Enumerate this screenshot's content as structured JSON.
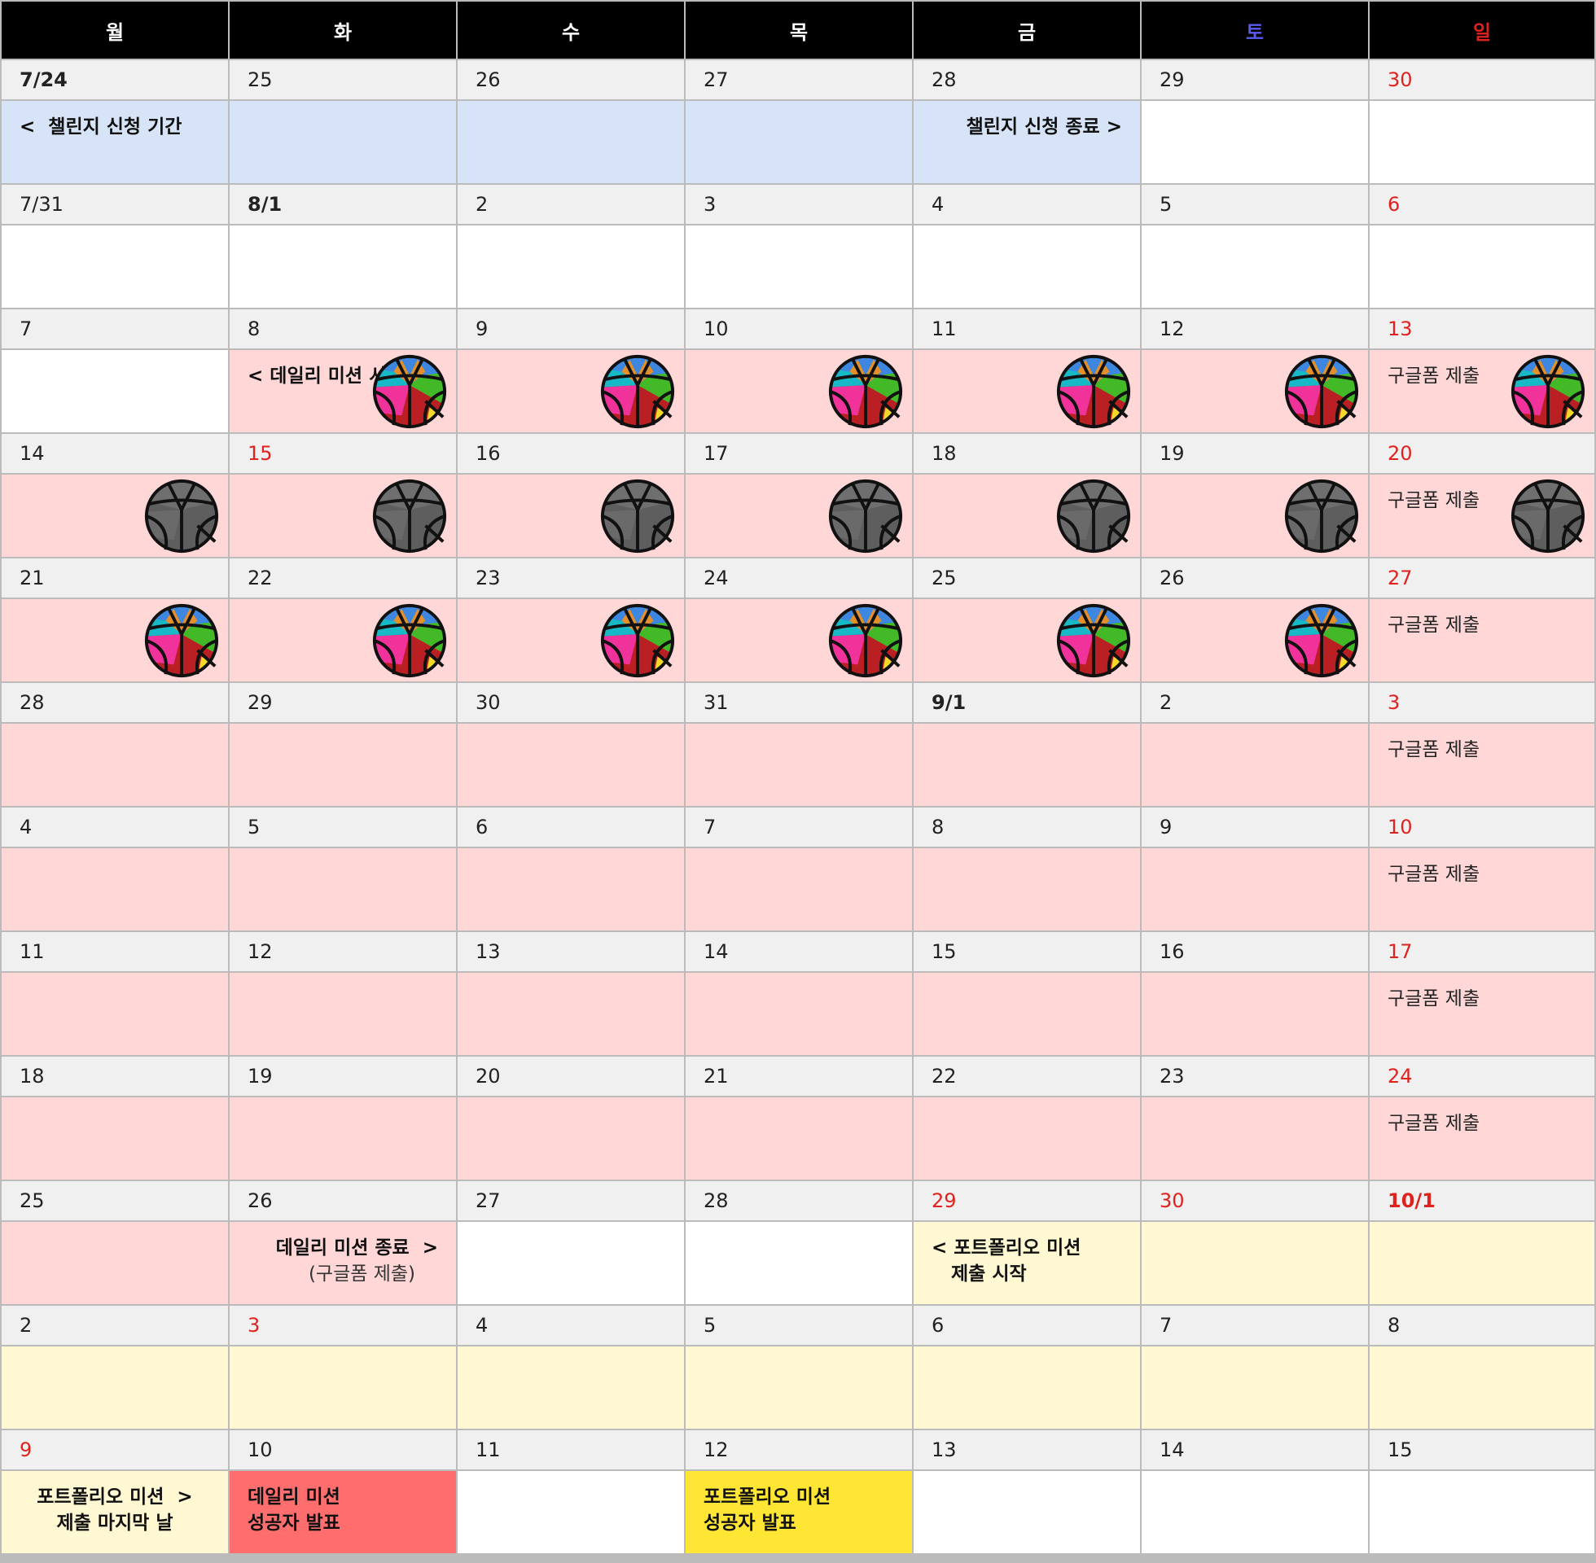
{
  "colors": {
    "header_bg": "#000000",
    "date_bg": "#f0f0f0",
    "signup": "#d7e4f7",
    "mission": "#ffd7d7",
    "portfolio": "#fff8d2",
    "daily_announce": "#ff6e6e",
    "portfolio_announce": "#ffe534",
    "red_day": "#e0221f",
    "blue_day": "#5b5bf0"
  },
  "weekdays": [
    {
      "label": "월",
      "color": "#ffffff"
    },
    {
      "label": "화",
      "color": "#ffffff"
    },
    {
      "label": "수",
      "color": "#ffffff"
    },
    {
      "label": "목",
      "color": "#ffffff"
    },
    {
      "label": "금",
      "color": "#ffffff"
    },
    {
      "label": "토",
      "color": "#5b5bf0"
    },
    {
      "label": "일",
      "color": "#e0221f"
    }
  ],
  "weeks": [
    {
      "dates": [
        {
          "t": "7/24",
          "b": true
        },
        {
          "t": "25"
        },
        {
          "t": "26"
        },
        {
          "t": "27"
        },
        {
          "t": "28"
        },
        {
          "t": "29"
        },
        {
          "t": "30",
          "red": true
        }
      ],
      "cells": [
        {
          "bg": "signup",
          "lines": [
            "<  챌린지 신청 기간"
          ],
          "align": "left"
        },
        {
          "bg": "signup"
        },
        {
          "bg": "signup"
        },
        {
          "bg": "signup"
        },
        {
          "bg": "signup",
          "lines": [
            "챌린지 신청 종료 >"
          ],
          "align": "right"
        },
        {},
        {}
      ]
    },
    {
      "dates": [
        {
          "t": "7/31"
        },
        {
          "t": "8/1",
          "b": true
        },
        {
          "t": "2"
        },
        {
          "t": "3"
        },
        {
          "t": "4"
        },
        {
          "t": "5"
        },
        {
          "t": "6",
          "red": true
        }
      ],
      "cells": [
        {},
        {},
        {},
        {},
        {},
        {},
        {}
      ]
    },
    {
      "dates": [
        {
          "t": "7"
        },
        {
          "t": "8"
        },
        {
          "t": "9"
        },
        {
          "t": "10"
        },
        {
          "t": "11"
        },
        {
          "t": "12"
        },
        {
          "t": "13",
          "red": true
        }
      ],
      "cells": [
        {},
        {
          "bg": "mission",
          "lines": [
            "< 데일리 미션 시"
          ],
          "align": "left",
          "ball": "color"
        },
        {
          "bg": "mission",
          "ball": "color"
        },
        {
          "bg": "mission",
          "ball": "color"
        },
        {
          "bg": "mission",
          "ball": "color"
        },
        {
          "bg": "mission",
          "ball": "color"
        },
        {
          "bg": "mission",
          "gf": "구글폼 제출",
          "ball": "color"
        }
      ]
    },
    {
      "dates": [
        {
          "t": "14"
        },
        {
          "t": "15",
          "red": true
        },
        {
          "t": "16"
        },
        {
          "t": "17"
        },
        {
          "t": "18"
        },
        {
          "t": "19"
        },
        {
          "t": "20",
          "red": true
        }
      ],
      "cells": [
        {
          "bg": "mission",
          "ball": "gray"
        },
        {
          "bg": "mission",
          "ball": "gray"
        },
        {
          "bg": "mission",
          "ball": "gray"
        },
        {
          "bg": "mission",
          "ball": "gray"
        },
        {
          "bg": "mission",
          "ball": "gray"
        },
        {
          "bg": "mission",
          "ball": "gray"
        },
        {
          "bg": "mission",
          "gf": "구글폼 제출",
          "ball": "gray"
        }
      ]
    },
    {
      "dates": [
        {
          "t": "21"
        },
        {
          "t": "22"
        },
        {
          "t": "23"
        },
        {
          "t": "24"
        },
        {
          "t": "25"
        },
        {
          "t": "26"
        },
        {
          "t": "27",
          "red": true
        }
      ],
      "cells": [
        {
          "bg": "mission",
          "ball": "color"
        },
        {
          "bg": "mission",
          "ball": "color"
        },
        {
          "bg": "mission",
          "ball": "color"
        },
        {
          "bg": "mission",
          "ball": "color"
        },
        {
          "bg": "mission",
          "ball": "color"
        },
        {
          "bg": "mission",
          "ball": "color"
        },
        {
          "bg": "mission",
          "gf": "구글폼 제출"
        }
      ]
    },
    {
      "dates": [
        {
          "t": "28"
        },
        {
          "t": "29"
        },
        {
          "t": "30"
        },
        {
          "t": "31"
        },
        {
          "t": "9/1",
          "b": true
        },
        {
          "t": "2"
        },
        {
          "t": "3",
          "red": true
        }
      ],
      "cells": [
        {
          "bg": "mission"
        },
        {
          "bg": "mission"
        },
        {
          "bg": "mission"
        },
        {
          "bg": "mission"
        },
        {
          "bg": "mission"
        },
        {
          "bg": "mission"
        },
        {
          "bg": "mission",
          "gf": "구글폼 제출"
        }
      ]
    },
    {
      "dates": [
        {
          "t": "4"
        },
        {
          "t": "5"
        },
        {
          "t": "6"
        },
        {
          "t": "7"
        },
        {
          "t": "8"
        },
        {
          "t": "9"
        },
        {
          "t": "10",
          "red": true
        }
      ],
      "cells": [
        {
          "bg": "mission"
        },
        {
          "bg": "mission"
        },
        {
          "bg": "mission"
        },
        {
          "bg": "mission"
        },
        {
          "bg": "mission"
        },
        {
          "bg": "mission"
        },
        {
          "bg": "mission",
          "gf": "구글폼 제출"
        }
      ]
    },
    {
      "dates": [
        {
          "t": "11"
        },
        {
          "t": "12"
        },
        {
          "t": "13"
        },
        {
          "t": "14"
        },
        {
          "t": "15"
        },
        {
          "t": "16"
        },
        {
          "t": "17",
          "red": true
        }
      ],
      "cells": [
        {
          "bg": "mission"
        },
        {
          "bg": "mission"
        },
        {
          "bg": "mission"
        },
        {
          "bg": "mission"
        },
        {
          "bg": "mission"
        },
        {
          "bg": "mission"
        },
        {
          "bg": "mission",
          "gf": "구글폼 제출"
        }
      ]
    },
    {
      "dates": [
        {
          "t": "18"
        },
        {
          "t": "19"
        },
        {
          "t": "20"
        },
        {
          "t": "21"
        },
        {
          "t": "22"
        },
        {
          "t": "23"
        },
        {
          "t": "24",
          "red": true
        }
      ],
      "cells": [
        {
          "bg": "mission"
        },
        {
          "bg": "mission"
        },
        {
          "bg": "mission"
        },
        {
          "bg": "mission"
        },
        {
          "bg": "mission"
        },
        {
          "bg": "mission"
        },
        {
          "bg": "mission",
          "gf": "구글폼 제출"
        }
      ]
    },
    {
      "dates": [
        {
          "t": "25"
        },
        {
          "t": "26"
        },
        {
          "t": "27"
        },
        {
          "t": "28"
        },
        {
          "t": "29",
          "red": true
        },
        {
          "t": "30",
          "red": true
        },
        {
          "t": "10/1",
          "red": true,
          "b": true
        }
      ],
      "cells": [
        {
          "bg": "mission"
        },
        {
          "bg": "mission",
          "lines": [
            "데일리 미션 종료  >"
          ],
          "sub": "(구글폼 제출)",
          "align": "right"
        },
        {},
        {},
        {
          "bg": "portfolio",
          "lines": [
            "< 포트폴리오 미션",
            "   제출 시작"
          ],
          "align": "left"
        },
        {
          "bg": "portfolio"
        },
        {
          "bg": "portfolio"
        }
      ]
    },
    {
      "dates": [
        {
          "t": "2"
        },
        {
          "t": "3",
          "red": true
        },
        {
          "t": "4"
        },
        {
          "t": "5"
        },
        {
          "t": "6"
        },
        {
          "t": "7"
        },
        {
          "t": "8"
        }
      ],
      "cells": [
        {
          "bg": "portfolio"
        },
        {
          "bg": "portfolio"
        },
        {
          "bg": "portfolio"
        },
        {
          "bg": "portfolio"
        },
        {
          "bg": "portfolio"
        },
        {
          "bg": "portfolio"
        },
        {
          "bg": "portfolio"
        }
      ]
    },
    {
      "dates": [
        {
          "t": "9",
          "red": true
        },
        {
          "t": "10"
        },
        {
          "t": "11"
        },
        {
          "t": "12"
        },
        {
          "t": "13"
        },
        {
          "t": "14"
        },
        {
          "t": "15"
        }
      ],
      "cells": [
        {
          "bg": "portfolio",
          "lines": [
            "포트폴리오 미션  >",
            "제출 마지막 날"
          ],
          "align": "center"
        },
        {
          "bg": "daily_announce",
          "lines": [
            "데일리 미션",
            "성공자 발표"
          ],
          "align": "left"
        },
        {},
        {
          "bg": "portfolio_announce",
          "lines": [
            "포트폴리오 미션",
            "성공자 발표"
          ],
          "align": "left"
        },
        {},
        {},
        {}
      ]
    }
  ]
}
